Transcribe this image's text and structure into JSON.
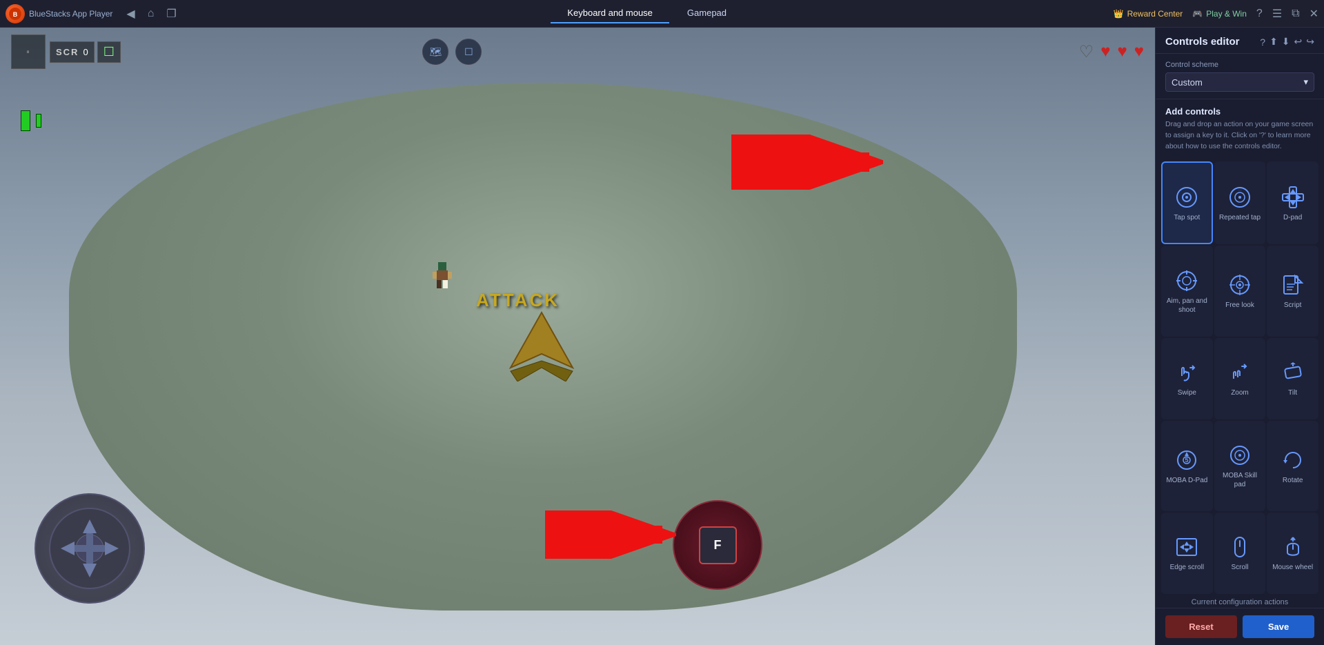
{
  "app": {
    "name": "BlueStacks App Player",
    "logo": "BS"
  },
  "topbar": {
    "tabs": [
      {
        "id": "keyboard",
        "label": "Keyboard and mouse",
        "active": true
      },
      {
        "id": "gamepad",
        "label": "Gamepad",
        "active": false
      }
    ],
    "reward_center": "Reward Center",
    "play_win": "Play & Win",
    "nav": {
      "back": "◀",
      "home": "⌂",
      "windows": "❐"
    }
  },
  "hud": {
    "score_label": "SCR",
    "score_value": "0",
    "hearts": [
      "🖤",
      "❤️",
      "❤️",
      "❤️"
    ]
  },
  "game": {
    "attack_label": "ATTACK"
  },
  "sidebar": {
    "title": "Controls editor",
    "scheme_label": "Control scheme",
    "scheme_value": "Custom",
    "add_controls_title": "Add controls",
    "add_controls_desc": "Drag and drop an action on your game screen to assign a key to it. Click on '?' to learn more about how to use the controls editor.",
    "controls": [
      {
        "id": "tap-spot",
        "label": "Tap spot",
        "icon": "○",
        "selected": true
      },
      {
        "id": "repeated-tap",
        "label": "Repeated tap",
        "icon": "⊙"
      },
      {
        "id": "dpad",
        "label": "D-pad",
        "icon": "✛"
      },
      {
        "id": "aim-pan-shoot",
        "label": "Aim, pan and shoot",
        "icon": "◎"
      },
      {
        "id": "free-look",
        "label": "Free look",
        "icon": "⊕"
      },
      {
        "id": "script",
        "label": "Script",
        "icon": "◈"
      },
      {
        "id": "swipe",
        "label": "Swipe",
        "icon": "☞"
      },
      {
        "id": "zoom",
        "label": "Zoom",
        "icon": "⚙"
      },
      {
        "id": "tilt",
        "label": "Tilt",
        "icon": "⬡"
      },
      {
        "id": "moba-dpad",
        "label": "MOBA D-Pad",
        "icon": "⊛"
      },
      {
        "id": "moba-skill",
        "label": "MOBA Skill pad",
        "icon": "⊚"
      },
      {
        "id": "rotate",
        "label": "Rotate",
        "icon": "↻"
      },
      {
        "id": "edge-scroll",
        "label": "Edge scroll",
        "icon": "⤡"
      },
      {
        "id": "scroll",
        "label": "Scroll",
        "icon": "▭"
      },
      {
        "id": "mouse-wheel",
        "label": "Mouse wheel",
        "icon": "🖱"
      }
    ],
    "actions_label": "Current configuration actions",
    "reset_label": "Reset",
    "save_label": "Save"
  },
  "colors": {
    "selected_border": "#4488ff",
    "sidebar_bg": "#1a1d30",
    "reset_bg": "#6a2020",
    "save_bg": "#2060cc"
  }
}
